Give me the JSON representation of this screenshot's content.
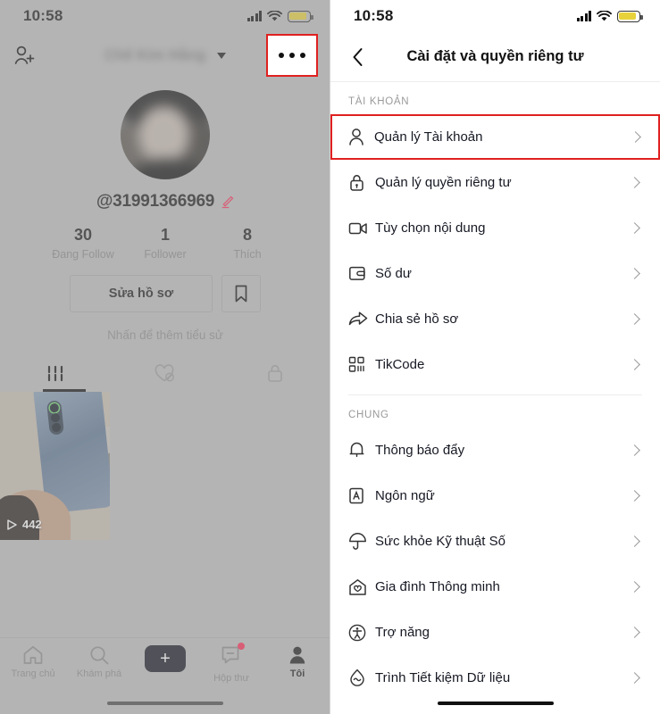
{
  "status_bar": {
    "time": "10:58",
    "signal_icon": "signal-bars-icon",
    "wifi_icon": "wifi-icon",
    "battery_icon": "battery-icon"
  },
  "left_panel": {
    "header": {
      "add_friend_icon": "add-person-icon",
      "profile_name": "Chế Kim Hằng",
      "dropdown_icon": "chevron-down-icon",
      "more_icon": "more-options-icon"
    },
    "profile": {
      "avatar": "user-avatar",
      "handle": "@31991366969",
      "edit_handle_icon": "pencil-icon",
      "stats": [
        {
          "value": "30",
          "label": "Đang Follow"
        },
        {
          "value": "1",
          "label": "Follower"
        },
        {
          "value": "8",
          "label": "Thích"
        }
      ],
      "edit_profile_label": "Sửa hồ sơ",
      "bookmark_icon": "bookmark-icon",
      "bio_placeholder": "Nhấn để thêm tiểu sử"
    },
    "tabs": [
      {
        "icon": "grid-posts-icon",
        "active": true
      },
      {
        "icon": "heart-liked-icon",
        "active": false
      },
      {
        "icon": "lock-private-icon",
        "active": false
      }
    ],
    "videos": [
      {
        "views": "442",
        "play_icon": "play-icon"
      }
    ],
    "bottom_nav": [
      {
        "icon": "home-icon",
        "label": "Trang chủ",
        "active": false
      },
      {
        "icon": "search-icon",
        "label": "Khám phá",
        "active": false
      },
      {
        "icon": "plus-icon",
        "label": "",
        "active": false
      },
      {
        "icon": "inbox-icon",
        "label": "Hộp thư",
        "active": false,
        "badge": true
      },
      {
        "icon": "person-icon",
        "label": "Tôi",
        "active": true
      }
    ]
  },
  "right_panel": {
    "header": {
      "back_icon": "chevron-left-icon",
      "title": "Cài đặt và quyền riêng tư"
    },
    "sections": [
      {
        "label": "TÀI KHOẢN",
        "items": [
          {
            "icon": "person-icon",
            "label": "Quản lý Tài khoản",
            "highlighted": true
          },
          {
            "icon": "lock-icon",
            "label": "Quản lý quyền riêng tư",
            "highlighted": false
          },
          {
            "icon": "video-camera-icon",
            "label": "Tùy chọn nội dung",
            "highlighted": false
          },
          {
            "icon": "wallet-icon",
            "label": "Số dư",
            "highlighted": false
          },
          {
            "icon": "share-arrow-icon",
            "label": "Chia sẻ hồ sơ",
            "highlighted": false
          },
          {
            "icon": "qr-code-icon",
            "label": "TikCode",
            "highlighted": false
          }
        ]
      },
      {
        "label": "CHUNG",
        "items": [
          {
            "icon": "bell-icon",
            "label": "Thông báo đẩy",
            "highlighted": false
          },
          {
            "icon": "language-icon",
            "label": "Ngôn ngữ",
            "highlighted": false
          },
          {
            "icon": "umbrella-icon",
            "label": "Sức khỏe Kỹ thuật Số",
            "highlighted": false
          },
          {
            "icon": "home-heart-icon",
            "label": "Gia đình Thông minh",
            "highlighted": false
          },
          {
            "icon": "accessibility-icon",
            "label": "Trợ năng",
            "highlighted": false
          },
          {
            "icon": "data-saver-icon",
            "label": "Trình Tiết kiệm Dữ liệu",
            "highlighted": false
          }
        ]
      }
    ],
    "chevron_icon": "chevron-right-icon"
  },
  "colors": {
    "highlight_red": "#e02020",
    "accent_pink": "#fe2c55",
    "accent_cyan": "#25f4ee",
    "battery_yellow": "#e8d23c"
  }
}
